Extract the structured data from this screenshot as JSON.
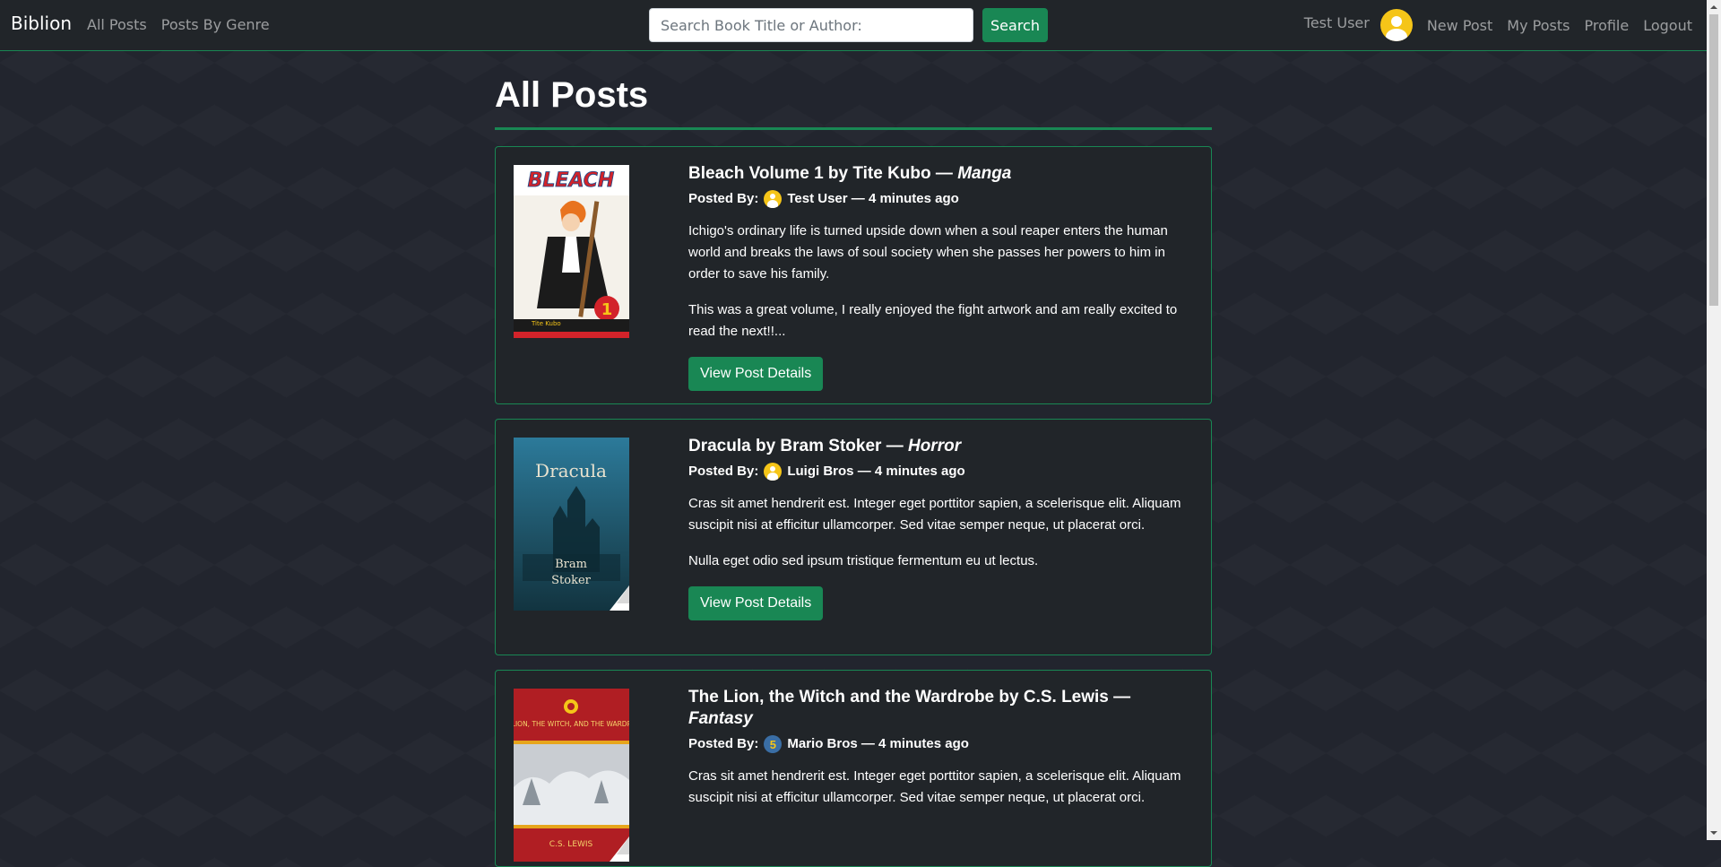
{
  "nav": {
    "brand": "Biblion",
    "links": [
      "All Posts",
      "Posts By Genre"
    ],
    "search_placeholder": "Search Book Title or Author:",
    "search_button": "Search",
    "user_name": "Test User",
    "right_links": [
      "New Post",
      "My Posts",
      "Profile",
      "Logout"
    ]
  },
  "page": {
    "title": "All Posts"
  },
  "posts": [
    {
      "title": "Bleach Volume 1 by Tite Kubo — ",
      "genre": "Manga",
      "posted_by_label": "Posted By:",
      "author": "Test User — 4 minutes ago",
      "description": "Ichigo's ordinary life is turned upside down when a soul reaper enters the human world and breaks the laws of soul society when she passes her powers to him in order to save his family.",
      "review": "This was a great volume, I really enjoyed the fight artwork and am really excited to read the next!!...",
      "button": "View Post Details",
      "cover_title": "BLEACH",
      "cover_author": "Tite Kubo"
    },
    {
      "title": "Dracula by Bram Stoker — ",
      "genre": "Horror",
      "posted_by_label": "Posted By:",
      "author": "Luigi Bros — 4 minutes ago",
      "description": "Cras sit amet hendrerit est. Integer eget porttitor sapien, a scelerisque elit. Aliquam suscipit nisi at efficitur ullamcorper. Sed vitae semper neque, ut placerat orci.",
      "review": "Nulla eget odio sed ipsum tristique fermentum eu ut lectus.",
      "button": "View Post Details",
      "cover_title": "Dracula",
      "cover_author_1": "Bram",
      "cover_author_2": "Stoker"
    },
    {
      "title": "The Lion, the Witch and the Wardrobe by C.S. Lewis — ",
      "genre": "Fantasy",
      "posted_by_label": "Posted By:",
      "author": "Mario Bros — 4 minutes ago",
      "avatar_badge": "5",
      "description": "Cras sit amet hendrerit est. Integer eget porttitor sapien, a scelerisque elit. Aliquam suscipit nisi at efficitur ullamcorper. Sed vitae semper neque, ut placerat orci.",
      "cover_title": "THE LION, THE WITCH, AND THE WARDROBE",
      "cover_author": "C.S. LEWIS"
    }
  ]
}
